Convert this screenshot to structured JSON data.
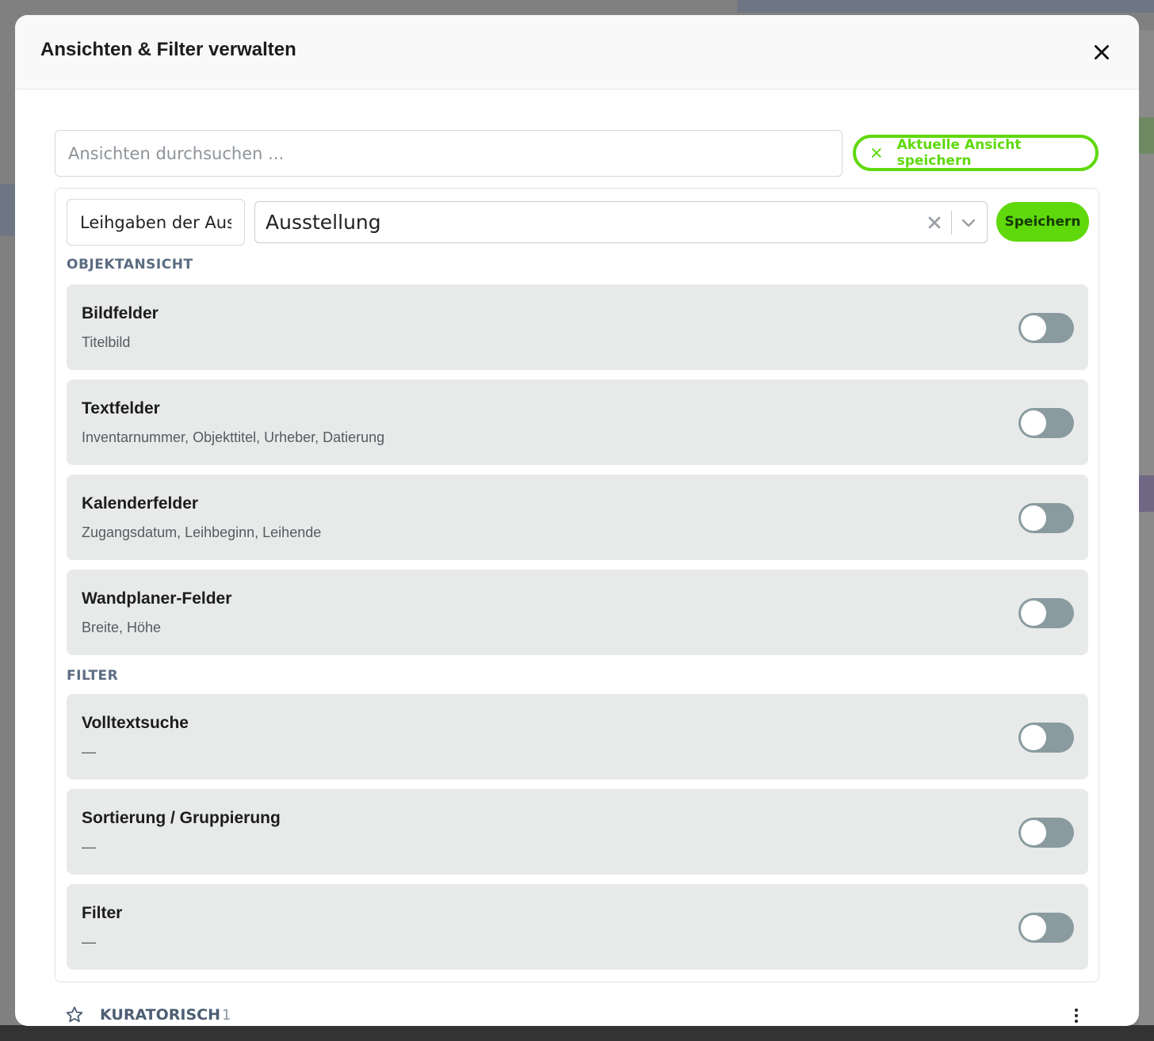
{
  "dialog": {
    "title": "Ansichten & Filter verwalten",
    "close_icon": "close-icon"
  },
  "search": {
    "placeholder": "Ansichten durchsuchen ...",
    "value": ""
  },
  "save_current_button": {
    "icon": "close-icon",
    "label": "Aktuelle Ansicht speichern",
    "color": "#5fd90c"
  },
  "editor": {
    "name_value": "Leihgaben der Ausstellung",
    "type_select": {
      "value": "Ausstellung",
      "clear_icon": "close-icon",
      "arrow_icon": "chevron-down-icon"
    },
    "save_label": "Speichern"
  },
  "sections": [
    {
      "title": "OBJEKTANSICHT",
      "items": [
        {
          "title": "Bildfelder",
          "subtitle": "Titelbild",
          "enabled": false
        },
        {
          "title": "Textfelder",
          "subtitle": "Inventarnummer, Objekttitel, Urheber, Datierung",
          "enabled": false
        },
        {
          "title": "Kalenderfelder",
          "subtitle": "Zugangsdatum, Leihbeginn, Leihende",
          "enabled": false
        },
        {
          "title": "Wandplaner-Felder",
          "subtitle": "Breite, Höhe",
          "enabled": false
        }
      ]
    },
    {
      "title": "FILTER",
      "items": [
        {
          "title": "Volltextsuche",
          "subtitle": "—",
          "enabled": false
        },
        {
          "title": "Sortierung / Gruppierung",
          "subtitle": "—",
          "enabled": false
        },
        {
          "title": "Filter",
          "subtitle": "—",
          "enabled": false
        }
      ]
    }
  ],
  "group": {
    "star_icon": "star-icon",
    "label": "KURATORISCH",
    "count": "1",
    "menu_icon": "more-vertical-icon"
  },
  "colors": {
    "accent": "#5fd90c",
    "section_title": "#5b6c82",
    "card_bg": "#e8eaea",
    "toggle_off": "#8a9ba0"
  }
}
